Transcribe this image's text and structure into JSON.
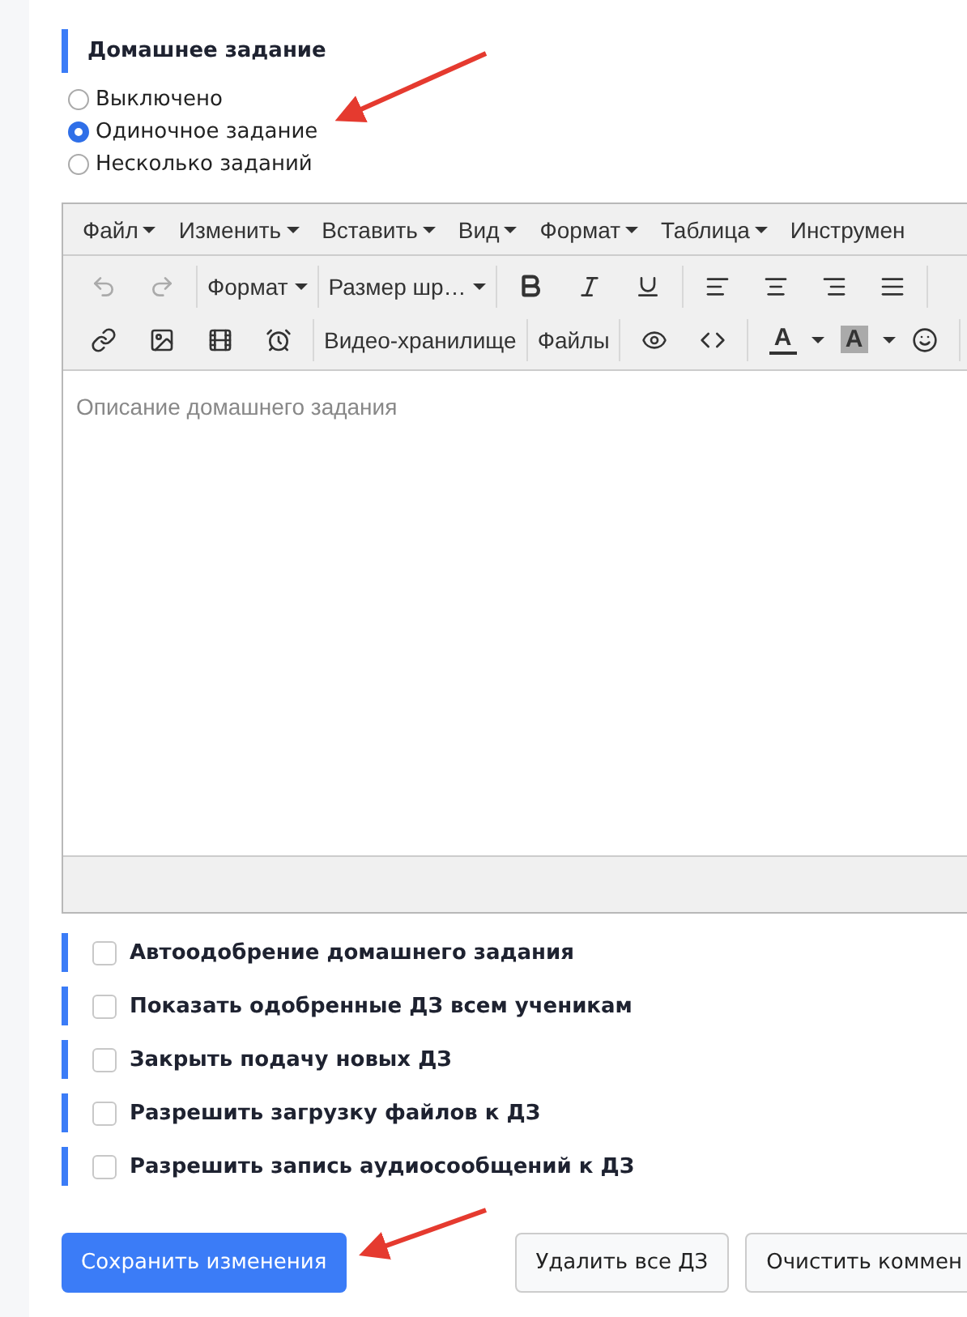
{
  "section_title": "Домашнее задание",
  "mode_options": [
    {
      "label": "Выключено",
      "selected": false
    },
    {
      "label": "Одиночное задание",
      "selected": true
    },
    {
      "label": "Несколько заданий",
      "selected": false
    }
  ],
  "editor": {
    "menu": [
      "Файл",
      "Изменить",
      "Вставить",
      "Вид",
      "Формат",
      "Таблица",
      "Инструмен"
    ],
    "undo": {
      "disabled": true
    },
    "redo": {
      "disabled": true
    },
    "format_dropdown": "Формат",
    "font_size_dropdown": "Размер шр…",
    "video_button": "Видео-хранилище",
    "files_button": "Файлы",
    "text_color": "A",
    "background_color": "A",
    "placeholder": "Описание домашнего задания"
  },
  "options": [
    {
      "label": "Автоодобрение домашнего задания",
      "checked": false
    },
    {
      "label": "Показать одобренные ДЗ всем ученикам",
      "checked": false
    },
    {
      "label": "Закрыть подачу новых ДЗ",
      "checked": false
    },
    {
      "label": "Разрешить загрузку файлов к ДЗ",
      "checked": false
    },
    {
      "label": "Разрешить запись аудиосообщений к ДЗ",
      "checked": false
    }
  ],
  "buttons": [
    {
      "label": "Сохранить изменения",
      "kind": "primary"
    },
    {
      "label": "Удалить все ДЗ",
      "kind": "secondary"
    },
    {
      "label": "Очистить коммен",
      "kind": "secondary"
    }
  ]
}
